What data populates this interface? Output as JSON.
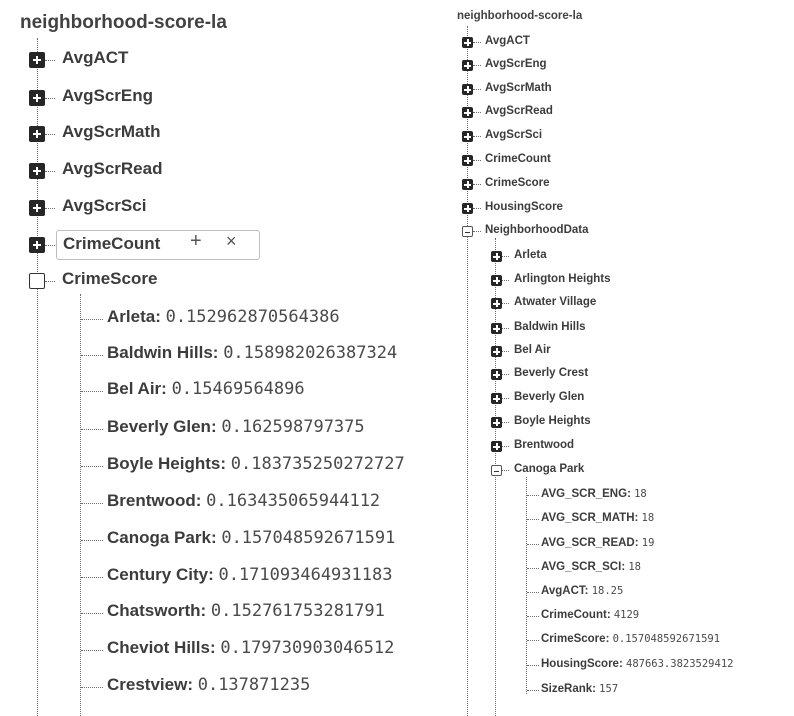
{
  "left": {
    "root": "neighborhood-score-la",
    "collapsed_nodes": [
      "AvgACT",
      "AvgScrEng",
      "AvgScrMath",
      "AvgScrRead",
      "AvgScrSci"
    ],
    "edit_node": {
      "label": "CrimeCount",
      "add_symbol": "+",
      "delete_symbol": "×"
    },
    "expanded_node": "CrimeScore",
    "leaves": [
      {
        "key": "Arleta",
        "value": "0.152962870564386"
      },
      {
        "key": "Baldwin Hills",
        "value": "0.158982026387324"
      },
      {
        "key": "Bel Air",
        "value": "0.15469564896"
      },
      {
        "key": "Beverly Glen",
        "value": "0.162598797375"
      },
      {
        "key": "Boyle Heights",
        "value": "0.183735250272727"
      },
      {
        "key": "Brentwood",
        "value": "0.163435065944112"
      },
      {
        "key": "Canoga Park",
        "value": "0.157048592671591"
      },
      {
        "key": "Century City",
        "value": "0.171093464931183"
      },
      {
        "key": "Chatsworth",
        "value": "0.152761753281791"
      },
      {
        "key": "Cheviot Hills",
        "value": "0.179730903046512"
      },
      {
        "key": "Crestview",
        "value": "0.137871235"
      }
    ]
  },
  "right": {
    "root": "neighborhood-score-la",
    "collapsed_nodes": [
      "AvgACT",
      "AvgScrEng",
      "AvgScrMath",
      "AvgScrRead",
      "AvgScrSci",
      "CrimeCount",
      "CrimeScore",
      "HousingScore"
    ],
    "expanded_node": "NeighborhoodData",
    "sub_nodes": [
      "Arleta",
      "Arlington Heights",
      "Atwater Village",
      "Baldwin Hills",
      "Bel Air",
      "Beverly Crest",
      "Beverly Glen",
      "Boyle Heights",
      "Brentwood"
    ],
    "expanded_sub": "Canoga Park",
    "leaves": [
      {
        "key": "AVG_SCR_ENG",
        "value": "18"
      },
      {
        "key": "AVG_SCR_MATH",
        "value": "18"
      },
      {
        "key": "AVG_SCR_READ",
        "value": "19"
      },
      {
        "key": "AVG_SCR_SCI",
        "value": "18"
      },
      {
        "key": "AvgACT",
        "value": "18.25"
      },
      {
        "key": "CrimeCount",
        "value": "4129"
      },
      {
        "key": "CrimeScore",
        "value": "0.157048592671591"
      },
      {
        "key": "HousingScore",
        "value": "487663.3823529412"
      },
      {
        "key": "SizeRank",
        "value": "157"
      }
    ]
  },
  "colors": {
    "text": "#3c3c3c",
    "toggle": "#262626",
    "guide": "#6b6b6b"
  },
  "icons": [
    "expand-plus-icon",
    "collapse-minus-icon"
  ]
}
